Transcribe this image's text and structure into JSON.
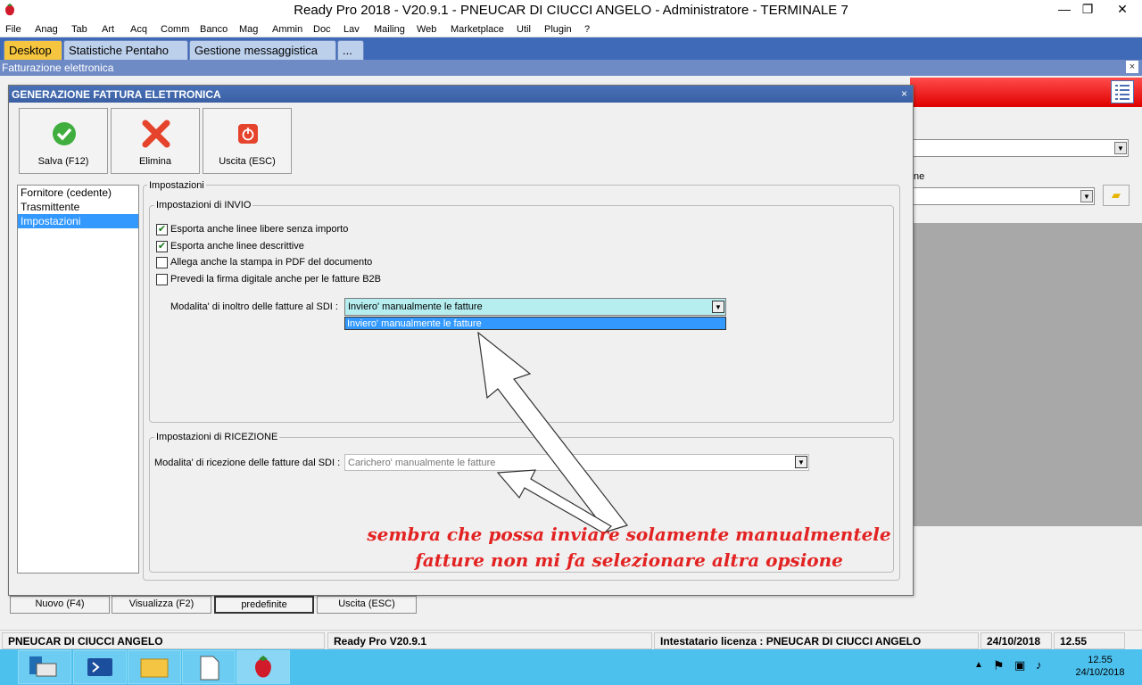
{
  "window": {
    "title": "Ready Pro 2018 - V20.9.1 - PNEUCAR DI CIUCCI ANGELO - Administratore - TERMINALE 7",
    "controls": [
      "—",
      "❐",
      "✕"
    ]
  },
  "menu": [
    "File",
    "Anag",
    "Tab",
    "Art",
    "Acq",
    "Comm",
    "Banco",
    "Mag",
    "Ammin",
    "Doc",
    "Lav",
    "Mailing",
    "Web",
    "Marketplace",
    "Util",
    "Plugin",
    "?"
  ],
  "tabs": [
    "Desktop",
    "Statistiche Pentaho",
    "Gestione messaggistica",
    "..."
  ],
  "subwindow": {
    "title": "Fatturazione elettronica",
    "close": "×"
  },
  "background": {
    "label_fragment": "ne",
    "buttons": [
      "Nuovo (F4)",
      "Visualizza (F2)",
      "predefinite",
      "Uscita (ESC)"
    ]
  },
  "dialog": {
    "title": "GENERAZIONE FATTURA ELETTRONICA",
    "close": "×",
    "toolbar": {
      "save": "Salva (F12)",
      "delete": "Elimina",
      "exit": "Uscita (ESC)"
    },
    "nav": [
      "Fornitore (cedente)",
      "Trasmittente",
      "Impostazioni"
    ],
    "settings_title": "Impostazioni",
    "send_group": {
      "title": "Impostazioni di INVIO",
      "options": [
        {
          "label": "Esporta anche linee libere senza importo",
          "checked": true
        },
        {
          "label": "Esporta anche linee descrittive",
          "checked": true
        },
        {
          "label": "Allega anche la stampa in PDF del documento",
          "checked": false
        },
        {
          "label": "Prevedi la firma digitale anche per le fatture B2B",
          "checked": false
        }
      ],
      "mode_label": "Modalita' di inoltro delle fatture al SDI :",
      "mode_value": "Inviero' manualmente le fatture",
      "dropdown_option": "Inviero' manualmente le fatture"
    },
    "receive_group": {
      "title": "Impostazioni di RICEZIONE",
      "mode_label": "Modalita' di ricezione delle fatture dal SDI :",
      "mode_value": "Carichero' manualmente le fatture"
    }
  },
  "annotation": {
    "line1": "sembra che possa inviare solamente manualmentele",
    "line2": "fatture non mi fa selezionare altra opsione",
    "color": "#e32222"
  },
  "statusbar": {
    "company": "PNEUCAR DI CIUCCI ANGELO",
    "version": "Ready Pro V20.9.1",
    "license": "Intestatario licenza : PNEUCAR DI CIUCCI ANGELO",
    "date": "24/10/2018",
    "time": "12.55"
  },
  "taskbar": {
    "clock_time": "12.55",
    "clock_date": "24/10/2018"
  }
}
